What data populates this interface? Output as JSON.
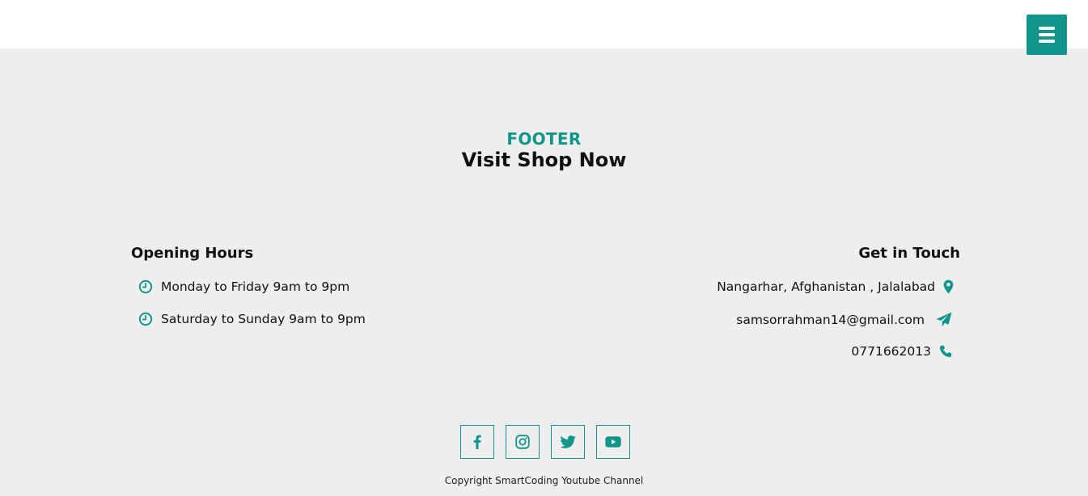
{
  "header": {
    "menu_icon": "hamburger-menu-icon"
  },
  "footer": {
    "kicker": "FOOTER",
    "title": "Visit Shop Now",
    "opening_hours": {
      "heading": "Opening Hours",
      "items": [
        {
          "text": "Monday to Friday 9am to 9pm",
          "icon": "clock-icon"
        },
        {
          "text": "Saturday to Sunday 9am to 9pm",
          "icon": "clock-icon"
        }
      ]
    },
    "contact": {
      "heading": "Get in Touch",
      "items": [
        {
          "text": "Nangarhar, Afghanistan , Jalalabad",
          "icon": "map-marker-icon"
        },
        {
          "text": "samsorrahman14@gmail.com",
          "icon": "paper-plane-icon"
        },
        {
          "text": "0771662013",
          "icon": "phone-icon"
        }
      ]
    },
    "socials": [
      {
        "name": "facebook",
        "icon": "facebook-icon"
      },
      {
        "name": "instagram",
        "icon": "instagram-icon"
      },
      {
        "name": "twitter",
        "icon": "twitter-icon"
      },
      {
        "name": "youtube",
        "icon": "youtube-icon"
      }
    ],
    "copyright": "Copyright SmartCoding Youtube Channel"
  },
  "colors": {
    "accent": "#10968a",
    "footer_bg": "#eeeeee",
    "text": "#111111"
  }
}
